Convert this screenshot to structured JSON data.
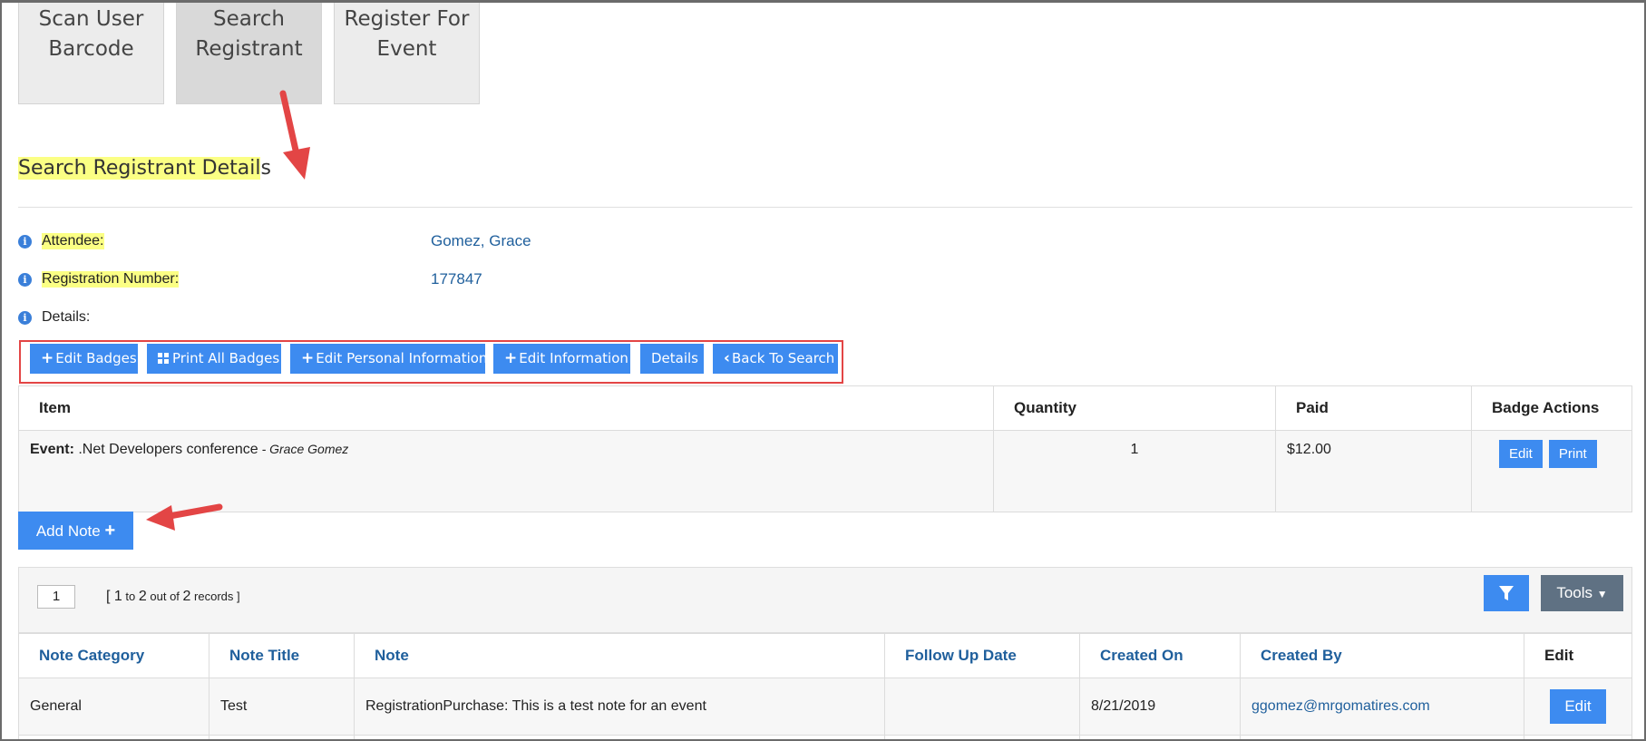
{
  "tabs": [
    {
      "label": "Scan User\nBarcode"
    },
    {
      "label": "Search\nRegistrant"
    },
    {
      "label": "Register For\nEvent"
    }
  ],
  "section": {
    "title_highlight": "Search Registrant Detail",
    "title_rest": "s"
  },
  "info": {
    "attendee_label": "Attendee:",
    "attendee_value": "Gomez, Grace",
    "regnum_label": "Registration Number:",
    "regnum_value": "177847",
    "details_label": "Details:"
  },
  "actions": {
    "edit_badges": "Edit Badges",
    "print_all_badges": "Print All Badges",
    "edit_personal_info": "Edit Personal Information",
    "edit_information": "Edit Information",
    "details": "Details",
    "back_to_search": "Back To Search"
  },
  "items_table": {
    "headers": [
      "Item",
      "Quantity",
      "Paid",
      "Badge Actions"
    ],
    "rows": [
      {
        "type_label": "Event:",
        "name": ".Net Developers conference",
        "attendee": " - Grace Gomez",
        "quantity": "1",
        "paid": "$12.00",
        "edit": "Edit",
        "print": "Print"
      }
    ]
  },
  "add_note": {
    "label": "Add Note"
  },
  "grid": {
    "page": "1",
    "range_open": "[ ",
    "from": "1",
    "to_word": " to ",
    "to": "2",
    "outof_word": " out of ",
    "total": "2",
    "records_word": " records ]",
    "tools_label": "Tools"
  },
  "notes_table": {
    "headers": [
      "Note Category",
      "Note Title",
      "Note",
      "Follow Up Date",
      "Created On",
      "Created By",
      "Edit"
    ],
    "rows": [
      {
        "category": "General",
        "title": "Test",
        "note": "RegistrationPurchase: This is a test note for an event",
        "follow_up": "",
        "created_on": "8/21/2019",
        "created_by": "ggomez@mrgomatires.com",
        "edit": "Edit"
      }
    ]
  },
  "colors": {
    "accent": "#3d8bf0",
    "highlight": "#fbff84",
    "annotation": "#e34545",
    "link": "#1f5f9c"
  }
}
